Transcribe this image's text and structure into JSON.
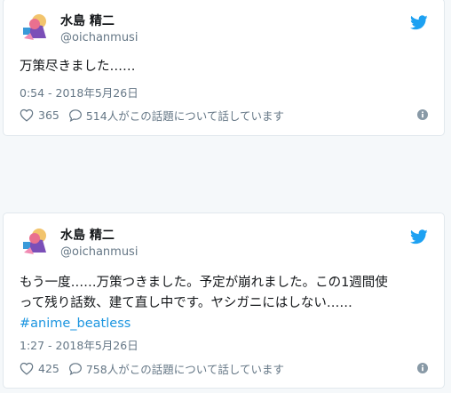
{
  "tweets": [
    {
      "author": {
        "name": "水島 精二",
        "handle": "@oichanmusi"
      },
      "text_lines": [
        "万策尽きました……"
      ],
      "hashtag": "",
      "timestamp": "0:54 - 2018年5月26日",
      "likes": "365",
      "replies_text": "514人がこの話題について話しています"
    },
    {
      "author": {
        "name": "水島 精二",
        "handle": "@oichanmusi"
      },
      "text_lines": [
        "もう一度……万策つきました。予定が崩れました。この1週間使",
        "って残り話数、建て直し中です。ヤシガニにはしない……"
      ],
      "hashtag": "#anime_beatless",
      "timestamp": "1:27 - 2018年5月26日",
      "likes": "425",
      "replies_text": "758人がこの話題について話しています"
    }
  ],
  "icons": {
    "brand": "twitter-bird-icon",
    "like": "heart-icon",
    "reply": "speech-bubble-icon",
    "info": "info-icon"
  },
  "colors": {
    "brand_blue": "#1da1f2",
    "hashtag": "#1b95e0",
    "secondary_text": "#657786",
    "card_border": "#e1e8ed",
    "page_background": "#f5f8fa"
  }
}
